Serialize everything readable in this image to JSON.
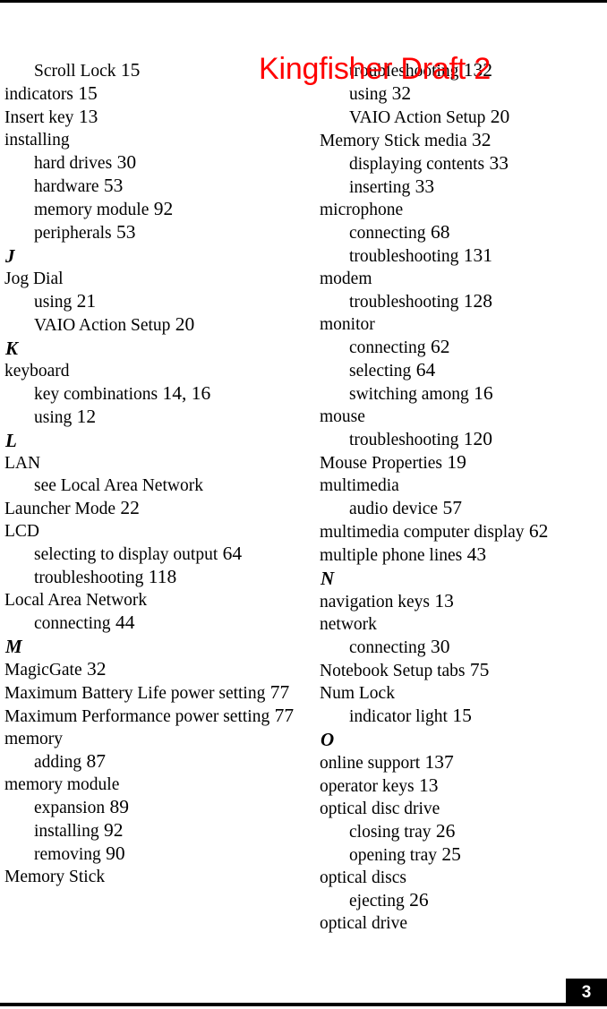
{
  "document": {
    "type": "index-page",
    "page_number": "3",
    "watermark": "Kingfisher Draft 2",
    "watermark_color": "#ff0000",
    "rule_color": "#000000",
    "page_badge_bg": "#000000",
    "page_badge_fg": "#ffffff"
  },
  "columns": {
    "left": [
      {
        "kind": "entry",
        "level": 2,
        "text": "Scroll Lock",
        "page": "15"
      },
      {
        "kind": "entry",
        "level": 1,
        "text": "indicators",
        "page": "15"
      },
      {
        "kind": "entry",
        "level": 1,
        "text": "Insert key",
        "page": "13"
      },
      {
        "kind": "entry",
        "level": 1,
        "text": "installing",
        "page": ""
      },
      {
        "kind": "entry",
        "level": 2,
        "text": "hard drives",
        "page": "30"
      },
      {
        "kind": "entry",
        "level": 2,
        "text": "hardware",
        "page": "53"
      },
      {
        "kind": "entry",
        "level": 2,
        "text": "memory module",
        "page": "92"
      },
      {
        "kind": "entry",
        "level": 2,
        "text": "peripherals",
        "page": "53"
      },
      {
        "kind": "letter",
        "text": "J"
      },
      {
        "kind": "entry",
        "level": 1,
        "text": "Jog Dial",
        "page": ""
      },
      {
        "kind": "entry",
        "level": 2,
        "text": "using",
        "page": "21"
      },
      {
        "kind": "entry",
        "level": 2,
        "text": "VAIO Action Setup",
        "page": "20"
      },
      {
        "kind": "letter",
        "text": "K"
      },
      {
        "kind": "entry",
        "level": 1,
        "text": "keyboard",
        "page": ""
      },
      {
        "kind": "entry",
        "level": 2,
        "text": "key combinations",
        "page": "14, 16"
      },
      {
        "kind": "entry",
        "level": 2,
        "text": "using",
        "page": "12"
      },
      {
        "kind": "letter",
        "text": "L"
      },
      {
        "kind": "entry",
        "level": 1,
        "text": "LAN",
        "page": ""
      },
      {
        "kind": "entry",
        "level": 2,
        "text": "see Local Area Network",
        "page": ""
      },
      {
        "kind": "entry",
        "level": 1,
        "text": "Launcher Mode",
        "page": "22"
      },
      {
        "kind": "entry",
        "level": 1,
        "text": "LCD",
        "page": ""
      },
      {
        "kind": "entry",
        "level": 2,
        "text": "selecting to display output",
        "page": "64"
      },
      {
        "kind": "entry",
        "level": 2,
        "text": "troubleshooting",
        "page": "118"
      },
      {
        "kind": "entry",
        "level": 1,
        "text": "Local Area Network",
        "page": ""
      },
      {
        "kind": "entry",
        "level": 2,
        "text": "connecting",
        "page": "44"
      },
      {
        "kind": "letter",
        "text": "M"
      },
      {
        "kind": "entry",
        "level": 1,
        "text": "MagicGate",
        "page": "32"
      },
      {
        "kind": "entry",
        "level": 1,
        "wrap": true,
        "text": "Maximum Battery Life power setting",
        "page": "77"
      },
      {
        "kind": "entry",
        "level": 1,
        "wrap": true,
        "text": "Maximum Performance power setting",
        "page": "77"
      },
      {
        "kind": "entry",
        "level": 1,
        "text": "memory",
        "page": ""
      },
      {
        "kind": "entry",
        "level": 2,
        "text": "adding",
        "page": "87"
      },
      {
        "kind": "entry",
        "level": 1,
        "text": "memory module",
        "page": ""
      },
      {
        "kind": "entry",
        "level": 2,
        "text": "expansion",
        "page": "89"
      },
      {
        "kind": "entry",
        "level": 2,
        "text": "installing",
        "page": "92"
      },
      {
        "kind": "entry",
        "level": 2,
        "text": "removing",
        "page": "90"
      },
      {
        "kind": "entry",
        "level": 1,
        "text": "Memory Stick",
        "page": ""
      }
    ],
    "right": [
      {
        "kind": "entry",
        "level": 2,
        "text": "troubleshooting",
        "page": "132"
      },
      {
        "kind": "entry",
        "level": 2,
        "text": "using",
        "page": "32"
      },
      {
        "kind": "entry",
        "level": 2,
        "text": "VAIO Action Setup",
        "page": "20"
      },
      {
        "kind": "entry",
        "level": 1,
        "text": "Memory Stick media",
        "page": "32"
      },
      {
        "kind": "entry",
        "level": 2,
        "text": "displaying contents",
        "page": "33"
      },
      {
        "kind": "entry",
        "level": 2,
        "text": "inserting",
        "page": "33"
      },
      {
        "kind": "entry",
        "level": 1,
        "text": "microphone",
        "page": ""
      },
      {
        "kind": "entry",
        "level": 2,
        "text": "connecting",
        "page": "68"
      },
      {
        "kind": "entry",
        "level": 2,
        "text": "troubleshooting",
        "page": "131"
      },
      {
        "kind": "entry",
        "level": 1,
        "text": "modem",
        "page": ""
      },
      {
        "kind": "entry",
        "level": 2,
        "text": "troubleshooting",
        "page": "128"
      },
      {
        "kind": "entry",
        "level": 1,
        "text": "monitor",
        "page": ""
      },
      {
        "kind": "entry",
        "level": 2,
        "text": "connecting",
        "page": "62"
      },
      {
        "kind": "entry",
        "level": 2,
        "text": "selecting",
        "page": "64"
      },
      {
        "kind": "entry",
        "level": 2,
        "text": "switching among",
        "page": "16"
      },
      {
        "kind": "entry",
        "level": 1,
        "text": "mouse",
        "page": ""
      },
      {
        "kind": "entry",
        "level": 2,
        "text": "troubleshooting",
        "page": "120"
      },
      {
        "kind": "entry",
        "level": 1,
        "text": "Mouse Properties",
        "page": "19"
      },
      {
        "kind": "entry",
        "level": 1,
        "text": "multimedia",
        "page": ""
      },
      {
        "kind": "entry",
        "level": 2,
        "text": "audio device",
        "page": "57"
      },
      {
        "kind": "entry",
        "level": 1,
        "text": "multimedia computer display",
        "page": "62"
      },
      {
        "kind": "entry",
        "level": 1,
        "text": "multiple phone lines",
        "page": "43"
      },
      {
        "kind": "letter",
        "text": "N"
      },
      {
        "kind": "entry",
        "level": 1,
        "text": "navigation keys",
        "page": "13"
      },
      {
        "kind": "entry",
        "level": 1,
        "text": "network",
        "page": ""
      },
      {
        "kind": "entry",
        "level": 2,
        "text": "connecting",
        "page": "30"
      },
      {
        "kind": "entry",
        "level": 1,
        "text": "Notebook Setup tabs",
        "page": "75"
      },
      {
        "kind": "entry",
        "level": 1,
        "text": "Num Lock",
        "page": ""
      },
      {
        "kind": "entry",
        "level": 2,
        "text": "indicator light",
        "page": "15"
      },
      {
        "kind": "letter",
        "text": "O"
      },
      {
        "kind": "entry",
        "level": 1,
        "text": "online support",
        "page": "137"
      },
      {
        "kind": "entry",
        "level": 1,
        "text": "operator keys",
        "page": "13"
      },
      {
        "kind": "entry",
        "level": 1,
        "text": "optical disc drive",
        "page": ""
      },
      {
        "kind": "entry",
        "level": 2,
        "text": "closing tray",
        "page": "26"
      },
      {
        "kind": "entry",
        "level": 2,
        "text": "opening tray",
        "page": "25"
      },
      {
        "kind": "entry",
        "level": 1,
        "text": "optical discs",
        "page": ""
      },
      {
        "kind": "entry",
        "level": 2,
        "text": "ejecting",
        "page": "26"
      },
      {
        "kind": "entry",
        "level": 1,
        "text": "optical drive",
        "page": ""
      }
    ]
  }
}
